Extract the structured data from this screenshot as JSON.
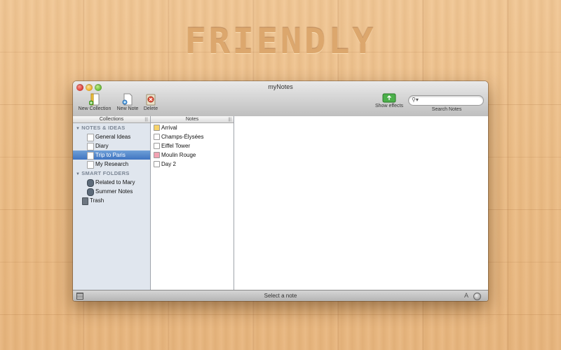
{
  "hero": {
    "title": "FRIENDLY"
  },
  "window": {
    "title": "myNotes"
  },
  "toolbar": {
    "new_collection": "New Collection",
    "new_note": "New Note",
    "delete": "Delete",
    "show_effects": "Show effects",
    "search_notes": "Search Notes",
    "search_value": ""
  },
  "sidebar": {
    "header": "Collections",
    "groups": [
      {
        "label": "NOTES & IDEAS",
        "items": [
          "General Ideas",
          "Diary",
          "Trip to Paris",
          "My Research"
        ],
        "selected": "Trip to Paris"
      },
      {
        "label": "SMART FOLDERS",
        "items": [
          "Related to Mary",
          "Summer Notes"
        ]
      }
    ],
    "trash": "Trash"
  },
  "notes": {
    "header": "Notes",
    "items": [
      {
        "label": "Arrival",
        "color": "#f7d36a"
      },
      {
        "label": "Champs-Élysées",
        "color": "#ffffff"
      },
      {
        "label": "Eiffel Tower",
        "color": "#ffffff"
      },
      {
        "label": "Moulin Rouge",
        "color": "#f2a3b3"
      },
      {
        "label": "Day 2",
        "color": "#ffffff"
      }
    ]
  },
  "status": {
    "text": "Select a note"
  },
  "icons": [
    "new-collection-icon",
    "new-note-icon",
    "delete-icon",
    "show-effects-icon",
    "search-icon",
    "folder-icon",
    "smart-folder-icon",
    "trash-icon",
    "font-icon",
    "action-icon"
  ]
}
